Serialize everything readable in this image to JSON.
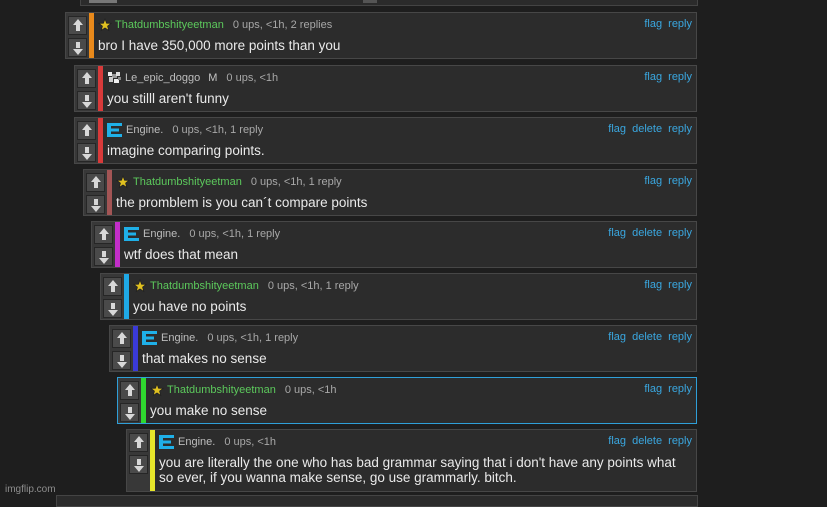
{
  "comments": [
    {
      "user": "Thatdumbshityeetman",
      "user_color": "#5cc95c",
      "icon": "star-icon",
      "mod": "",
      "meta": "0 ups, <1h, 2 replies",
      "text": "bro I have 350,000 more points than you",
      "actions": {
        "flag": "flag",
        "delete": "",
        "reply": "reply"
      },
      "bar_color": "#e8891b"
    },
    {
      "user": "Le_epic_doggo",
      "user_color": "#bdbdbd",
      "icon": "doggo-avatar-icon",
      "mod": "M",
      "meta": "0 ups, <1h",
      "text": "you stilll aren't funny",
      "actions": {
        "flag": "flag",
        "delete": "",
        "reply": "reply"
      },
      "bar_color": "#d83a3a"
    },
    {
      "user": "Engine.",
      "user_color": "#bdbdbd",
      "icon": "engine-icon",
      "mod": "",
      "meta": "0 ups, <1h, 1 reply",
      "text": "imagine comparing points.",
      "actions": {
        "flag": "flag",
        "delete": "delete",
        "reply": "reply"
      },
      "bar_color": "#d83a3a"
    },
    {
      "user": "Thatdumbshityeetman",
      "user_color": "#5cc95c",
      "icon": "star-icon",
      "mod": "",
      "meta": "0 ups, <1h, 1 reply",
      "text": "the promblem is you can´t compare points",
      "actions": {
        "flag": "flag",
        "delete": "",
        "reply": "reply"
      },
      "bar_color": "#a35555"
    },
    {
      "user": "Engine.",
      "user_color": "#bdbdbd",
      "icon": "engine-icon",
      "mod": "",
      "meta": "0 ups, <1h, 1 reply",
      "text": "wtf does that mean",
      "actions": {
        "flag": "flag",
        "delete": "delete",
        "reply": "reply"
      },
      "bar_color": "#c22ec9"
    },
    {
      "user": "Thatdumbshityeetman",
      "user_color": "#5cc95c",
      "icon": "star-icon",
      "mod": "",
      "meta": "0 ups, <1h, 1 reply",
      "text": "you have no points",
      "actions": {
        "flag": "flag",
        "delete": "",
        "reply": "reply"
      },
      "bar_color": "#1fa9e6"
    },
    {
      "user": "Engine.",
      "user_color": "#bdbdbd",
      "icon": "engine-icon",
      "mod": "",
      "meta": "0 ups, <1h, 1 reply",
      "text": "that makes no sense",
      "actions": {
        "flag": "flag",
        "delete": "delete",
        "reply": "reply"
      },
      "bar_color": "#3a3ad8"
    },
    {
      "user": "Thatdumbshityeetman",
      "user_color": "#5cc95c",
      "icon": "star-icon",
      "mod": "",
      "meta": "0 ups, <1h",
      "text": "you make no sense",
      "actions": {
        "flag": "flag",
        "delete": "",
        "reply": "reply"
      },
      "bar_color": "#2fd82f"
    },
    {
      "user": "Engine.",
      "user_color": "#bdbdbd",
      "icon": "engine-icon",
      "mod": "",
      "meta": "0 ups, <1h",
      "text": "you are literally the one who has bad grammar saying that i don't have any points what so ever, if you wanna make sense, go use grammarly. bitch.",
      "actions": {
        "flag": "flag",
        "delete": "delete",
        "reply": "reply"
      },
      "bar_color": "#e6e62a"
    }
  ],
  "watermark": "imgflip.com",
  "colors": {
    "link": "#3aa7e0",
    "background": "#1e1e1e",
    "panel": "#2c2c2c",
    "highlight_border": "#2f9fd8"
  }
}
